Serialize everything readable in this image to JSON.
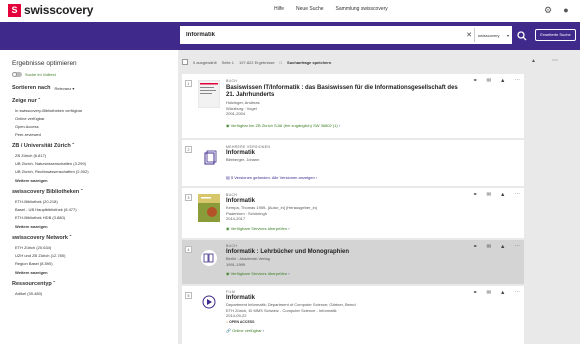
{
  "header": {
    "logo_mark": "S",
    "logo_text": "swisscovery",
    "links": [
      "Hilfe",
      "Neue Suche",
      "Sammlung swisscovery"
    ]
  },
  "search": {
    "value": "Informatik",
    "scope": "swisscovery",
    "advanced_label": "Erweiterte Suche"
  },
  "sidebar": {
    "title": "Ergebnisse optimieren",
    "fulltext_toggle": "Suche im Volltext",
    "sort_label": "Sortieren nach",
    "sort_value": "Relevanz",
    "facets": [
      {
        "heading": "Zeige nur",
        "items": [
          "In swisscovery-Bibliotheken verfügbar",
          "Online verfügbar",
          "Open Access",
          "Peer-reviewed"
        ],
        "more": ""
      },
      {
        "heading": "ZB / Universität Zürich",
        "items": [
          "ZB Zürich (6.817)",
          "UB Zürich, Naturwissenschaften (3.299)",
          "UB Zürich, Rechtswissenschaften (2.002)"
        ],
        "more": "Weitere anzeigen"
      },
      {
        "heading": "swisscovery Bibliotheken",
        "items": [
          "ETH-Bibliothek (20.218)",
          "Basel - UB Hauptbibliothek (8.477)",
          "ETH-Bibliothek HDB (3.880)"
        ],
        "more": "Weitere anzeigen"
      },
      {
        "heading": "swisscovery Network",
        "items": [
          "ETH Zürich (20.634)",
          "UZH und ZB Zürich (12.780)",
          "Region Basel (8.590)"
        ],
        "more": "Weitere anzeigen"
      },
      {
        "heading": "Ressourcentyp",
        "items": [
          "Artikel (39.480)"
        ],
        "more": ""
      }
    ]
  },
  "results_header": {
    "selected": "0 ausgewählt",
    "page": "Seite 1",
    "count": "197.822 Ergebnisse",
    "save": "Suchanfrage speichern"
  },
  "results": [
    {
      "num": "1",
      "type": "BUCH",
      "title": "Basiswissen IT/Informatik : das Basiswissen für die Informationsgesellschaft des 21. Jahrhunderts",
      "meta": [
        "Holzinger, Andreas",
        "Würzburg : Vogel",
        "2001-2004"
      ],
      "avail": "Verfügbar bei ZB Zürich  SJAI (frei zugänglich) SW 36802 (1)",
      "open_access": ""
    },
    {
      "num": "2",
      "type": "MEHRERE VERSIONEN",
      "title": "Informatik",
      "meta": [
        "Blieberger, Johann"
      ],
      "avail": "5 Versionen gefunden. Alle Versionen anzeigen",
      "open_access": ""
    },
    {
      "num": "3",
      "type": "BUCH",
      "title": "Informatik",
      "meta": [
        "Kempa, Thomas 1959- [Autor_in] (Herausgeber_in)",
        "Paderborn : Schöningh",
        "2014-2017"
      ],
      "avail": "Verfügbare Services überprüfen",
      "open_access": ""
    },
    {
      "num": "4",
      "type": "BUCH",
      "title": "Informatik : Lehrbücher und Monographien",
      "meta": [
        "Berlin : Akademie-Verlag",
        "1991-1999"
      ],
      "avail": "Verfügbare Services überprüfen",
      "open_access": ""
    },
    {
      "num": "5",
      "type": "FILM",
      "title": "Informatik",
      "meta": [
        "Department Informatik; Department of Computer Science; Gärtner, Bernd",
        "ETH Zürich, ID MMS Schweiz - Computer Science - Informatik",
        "2014-09-22"
      ],
      "avail": "Online verfügbar",
      "open_access": "OPEN ACCESS"
    }
  ]
}
